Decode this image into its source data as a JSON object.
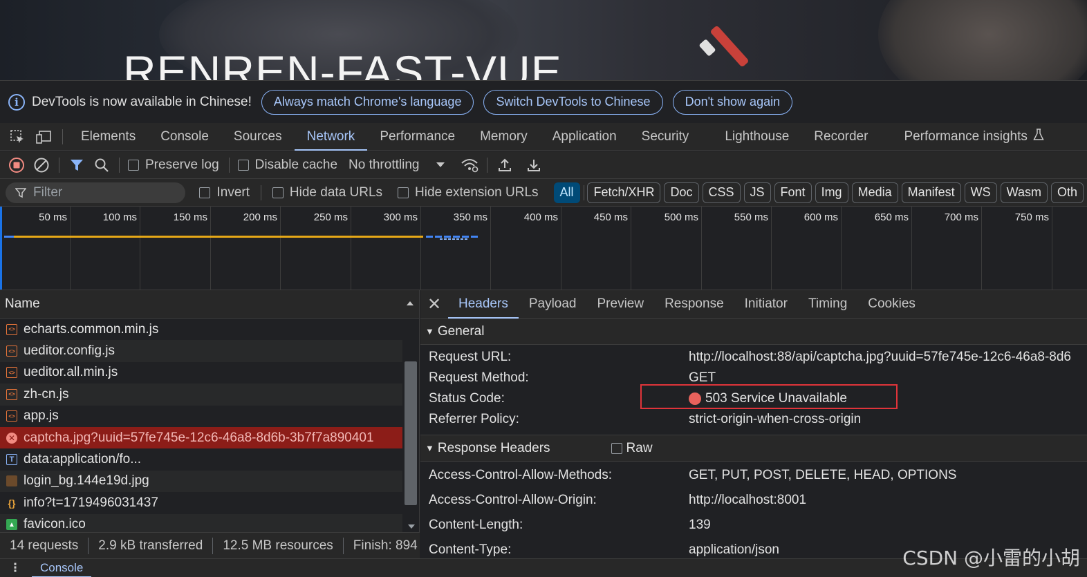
{
  "hero": {
    "title": "RENREN-FAST-VUE"
  },
  "infobar": {
    "message": "DevTools is now available in Chinese!",
    "buttons": [
      "Always match Chrome's language",
      "Switch DevTools to Chinese",
      "Don't show again"
    ]
  },
  "main_tabs": [
    "Elements",
    "Console",
    "Sources",
    "Network",
    "Performance",
    "Memory",
    "Application",
    "Security",
    "Lighthouse",
    "Recorder",
    "Performance insights"
  ],
  "active_main_tab": "Network",
  "network_toolbar": {
    "preserve_log": "Preserve log",
    "disable_cache": "Disable cache",
    "throttling": "No throttling"
  },
  "filterbar": {
    "filter_placeholder": "Filter",
    "invert": "Invert",
    "hide_data_urls": "Hide data URLs",
    "hide_extension_urls": "Hide extension URLs",
    "types": [
      "All",
      "Fetch/XHR",
      "Doc",
      "CSS",
      "JS",
      "Font",
      "Img",
      "Media",
      "Manifest",
      "WS",
      "Wasm",
      "Oth"
    ],
    "active_type": "All"
  },
  "timeline": {
    "ticks": [
      "50 ms",
      "100 ms",
      "150 ms",
      "200 ms",
      "250 ms",
      "300 ms",
      "350 ms",
      "400 ms",
      "450 ms",
      "500 ms",
      "550 ms",
      "600 ms",
      "650 ms",
      "700 ms",
      "750 ms",
      "8"
    ]
  },
  "request_list": {
    "header": "Name",
    "rows": [
      {
        "name": "echarts.common.min.js",
        "type": "script"
      },
      {
        "name": "ueditor.config.js",
        "type": "script"
      },
      {
        "name": "ueditor.all.min.js",
        "type": "script"
      },
      {
        "name": "zh-cn.js",
        "type": "script"
      },
      {
        "name": "app.js",
        "type": "script"
      },
      {
        "name": "captcha.jpg?uuid=57fe745e-12c6-46a8-8d6b-3b7f7a890401",
        "type": "error"
      },
      {
        "name": "data:application/fo...",
        "type": "text"
      },
      {
        "name": "login_bg.144e19d.jpg",
        "type": "img"
      },
      {
        "name": "info?t=1719496031437",
        "type": "fetch"
      },
      {
        "name": "favicon.ico",
        "type": "favicon"
      }
    ]
  },
  "summary": {
    "requests": "14 requests",
    "transferred": "2.9 kB transferred",
    "resources": "12.5 MB resources",
    "finish": "Finish: 894"
  },
  "details": {
    "tabs": [
      "Headers",
      "Payload",
      "Preview",
      "Response",
      "Initiator",
      "Timing",
      "Cookies"
    ],
    "active_tab": "Headers",
    "general_title": "General",
    "general": [
      {
        "key": "Request URL:",
        "value": "http://localhost:88/api/captcha.jpg?uuid=57fe745e-12c6-46a8-8d6"
      },
      {
        "key": "Request Method:",
        "value": "GET"
      },
      {
        "key": "Status Code:",
        "value": "503 Service Unavailable"
      },
      {
        "key": "Referrer Policy:",
        "value": "strict-origin-when-cross-origin"
      }
    ],
    "response_headers_title": "Response Headers",
    "raw_label": "Raw",
    "response_headers": [
      {
        "key": "Access-Control-Allow-Methods:",
        "value": "GET, PUT, POST, DELETE, HEAD, OPTIONS"
      },
      {
        "key": "Access-Control-Allow-Origin:",
        "value": "http://localhost:8001"
      },
      {
        "key": "Content-Length:",
        "value": "139"
      },
      {
        "key": "Content-Type:",
        "value": "application/json"
      }
    ]
  },
  "drawer": {
    "tab": "Console"
  },
  "watermark": "CSDN @小雷的小胡"
}
